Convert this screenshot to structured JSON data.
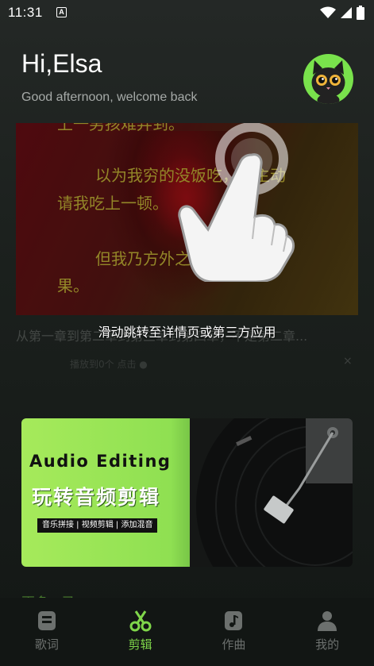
{
  "status_bar": {
    "time": "11:31",
    "indicator": "A",
    "icons": [
      "wifi-icon",
      "signal-icon",
      "battery-icon"
    ]
  },
  "header": {
    "greeting": "Hi,Elsa",
    "subtitle": "Good afternoon, welcome back"
  },
  "feature_card": {
    "lyric_lines": [
      "上一男孩难弃到。",
      "以为我穷的没饭吃，便主动",
      "请我吃上一顿。",
      "但我乃方外之人，最惧欠因",
      "果。"
    ],
    "title": "从第一章到第二章到第三章到第四章，不是第二章...",
    "meta": "播放到0个 点击 ●",
    "close_icon": "×",
    "hint_text": "滑动跳转至详情页或第三方应用"
  },
  "banner": {
    "title_en": "Audio Editing",
    "title_cn": "玩转音频剪辑",
    "tags": "音乐拼接 | 视频剪辑 | 添加混音"
  },
  "section_peek": "更多 · 录",
  "bottom_nav": {
    "items": [
      {
        "label": "歌词",
        "icon": "lyrics-icon",
        "active": false
      },
      {
        "label": "剪辑",
        "icon": "scissors-icon",
        "active": true
      },
      {
        "label": "作曲",
        "icon": "music-note-icon",
        "active": false
      },
      {
        "label": "我的",
        "icon": "profile-icon",
        "active": false
      }
    ]
  },
  "colors": {
    "accent": "#7fd64a",
    "background": "#161a18",
    "avatar_bg": "#79e24c"
  }
}
